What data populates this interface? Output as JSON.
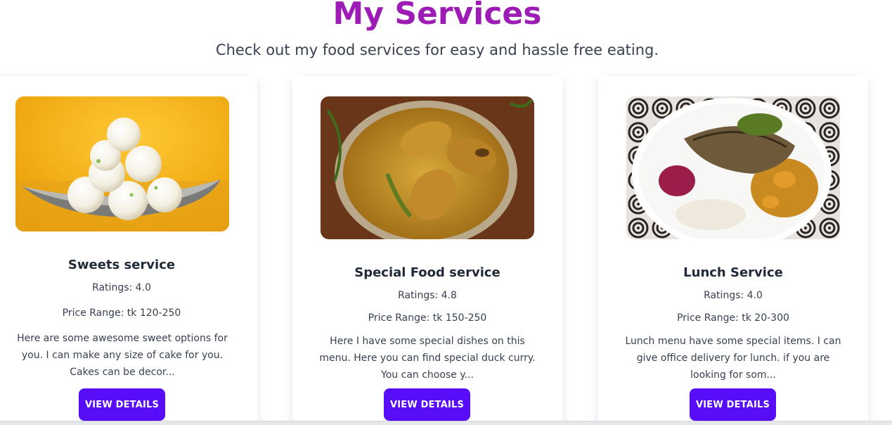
{
  "header": {
    "title": "My Services",
    "subtitle": "Check out my food services for easy and hassle free eating."
  },
  "colors": {
    "title": "#9d1cb5",
    "button": "#570df8"
  },
  "services": [
    {
      "image_icon": "sweets-image",
      "title": "Sweets service",
      "rating": "Ratings: 4.0",
      "price": "Price Range: tk 120-250",
      "description": "Here are some awesome sweet options for you. I can make any size of cake for you. Cakes can be decor...",
      "button_label": "VIEW DETAILS"
    },
    {
      "image_icon": "fish-curry-image",
      "title": "Special Food service",
      "rating": "Ratings: 4.8",
      "price": "Price Range: tk 150-250",
      "description": "Here I have some special dishes on this menu. Here you can find special duck curry. You can choose y...",
      "button_label": "VIEW DETAILS"
    },
    {
      "image_icon": "lunch-plate-image",
      "title": "Lunch Service",
      "rating": "Ratings: 4.0",
      "price": "Price Range: tk 20-300",
      "description": "Lunch menu have some special items. I can give office delivery for lunch. if you are looking for som...",
      "button_label": "VIEW DETAILS"
    }
  ]
}
